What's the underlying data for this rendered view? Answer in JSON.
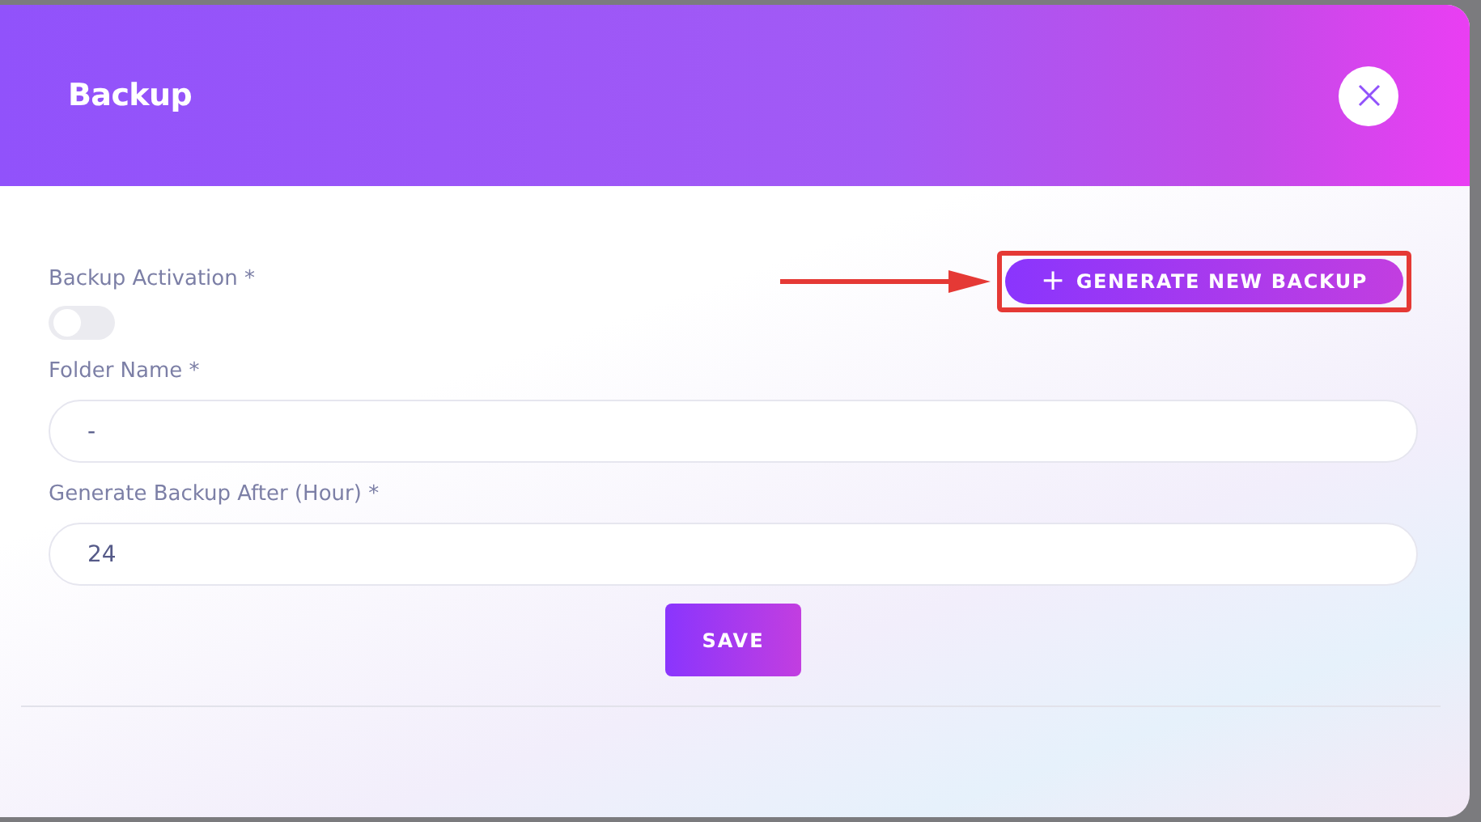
{
  "dialog": {
    "title": "Backup"
  },
  "activation": {
    "label": "Backup Activation *",
    "on": false
  },
  "generate_button": {
    "icon": "+",
    "label": "GENERATE NEW BACKUP",
    "highlighted": true
  },
  "fields": [
    {
      "label": "Folder Name *",
      "value": "-"
    },
    {
      "label": "Generate Backup After (Hour) *",
      "value": "24"
    }
  ],
  "save_button": {
    "label": "SAVE"
  }
}
